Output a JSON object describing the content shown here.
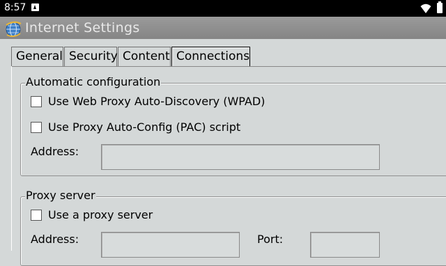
{
  "status_bar": {
    "time": "8:57",
    "icons": [
      "notification-icon",
      "wifi-icon",
      "battery-icon"
    ]
  },
  "window": {
    "title": "Internet Settings",
    "icon": "globe-icon"
  },
  "tabs": [
    {
      "label": "General",
      "active": false
    },
    {
      "label": "Security",
      "active": false
    },
    {
      "label": "Content",
      "active": false
    },
    {
      "label": "Connections",
      "active": true
    }
  ],
  "automatic_configuration": {
    "legend": "Automatic configuration",
    "wpad_label": "Use Web Proxy Auto-Discovery (WPAD)",
    "wpad_checked": false,
    "pac_label": "Use Proxy Auto-Config (PAC) script",
    "pac_checked": false,
    "address_label": "Address:",
    "address_value": ""
  },
  "proxy_server": {
    "legend": "Proxy server",
    "use_proxy_label": "Use a proxy server",
    "use_proxy_checked": false,
    "address_label": "Address:",
    "address_value": "",
    "port_label": "Port:",
    "port_value": ""
  },
  "colors": {
    "background": "#d4d8d8",
    "titlebar": "#8c8c8c",
    "title_text": "#e8e8e8"
  }
}
